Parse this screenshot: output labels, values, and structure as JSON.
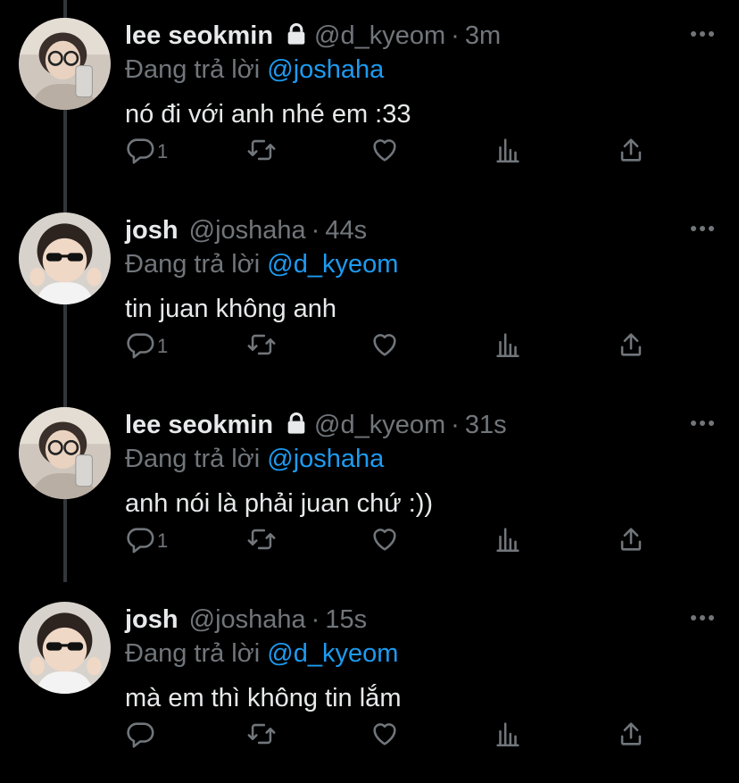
{
  "tweets": [
    {
      "name": "lee seokmin",
      "locked": true,
      "handle": "@d_kyeom",
      "time": "3m",
      "reply_prefix": "Đang trả lời",
      "reply_to": "@joshaha",
      "text": "nó đi với anh nhé em :33",
      "reply_count": "1",
      "avatar_icon": "person-with-glasses-avatar"
    },
    {
      "name": "josh",
      "locked": false,
      "handle": "@joshaha",
      "time": "44s",
      "reply_prefix": "Đang trả lời",
      "reply_to": "@d_kyeom",
      "text": "tin juan không anh",
      "reply_count": "1",
      "avatar_icon": "baby-with-sunglasses-avatar"
    },
    {
      "name": "lee seokmin",
      "locked": true,
      "handle": "@d_kyeom",
      "time": "31s",
      "reply_prefix": "Đang trả lời",
      "reply_to": "@joshaha",
      "text": "anh nói là phải juan chứ :))",
      "reply_count": "1",
      "avatar_icon": "person-with-glasses-avatar"
    },
    {
      "name": "josh",
      "locked": false,
      "handle": "@joshaha",
      "time": "15s",
      "reply_prefix": "Đang trả lời",
      "reply_to": "@d_kyeom",
      "text": "mà em thì không tin lắm",
      "reply_count": "",
      "avatar_icon": "baby-with-sunglasses-avatar"
    }
  ],
  "colors": {
    "background": "#000000",
    "text": "#e7e9ea",
    "muted": "#71767b",
    "link": "#1d9bf0"
  },
  "icons": [
    "reply-icon",
    "retweet-icon",
    "like-icon",
    "analytics-icon",
    "share-icon",
    "more-icon",
    "lock-icon"
  ]
}
